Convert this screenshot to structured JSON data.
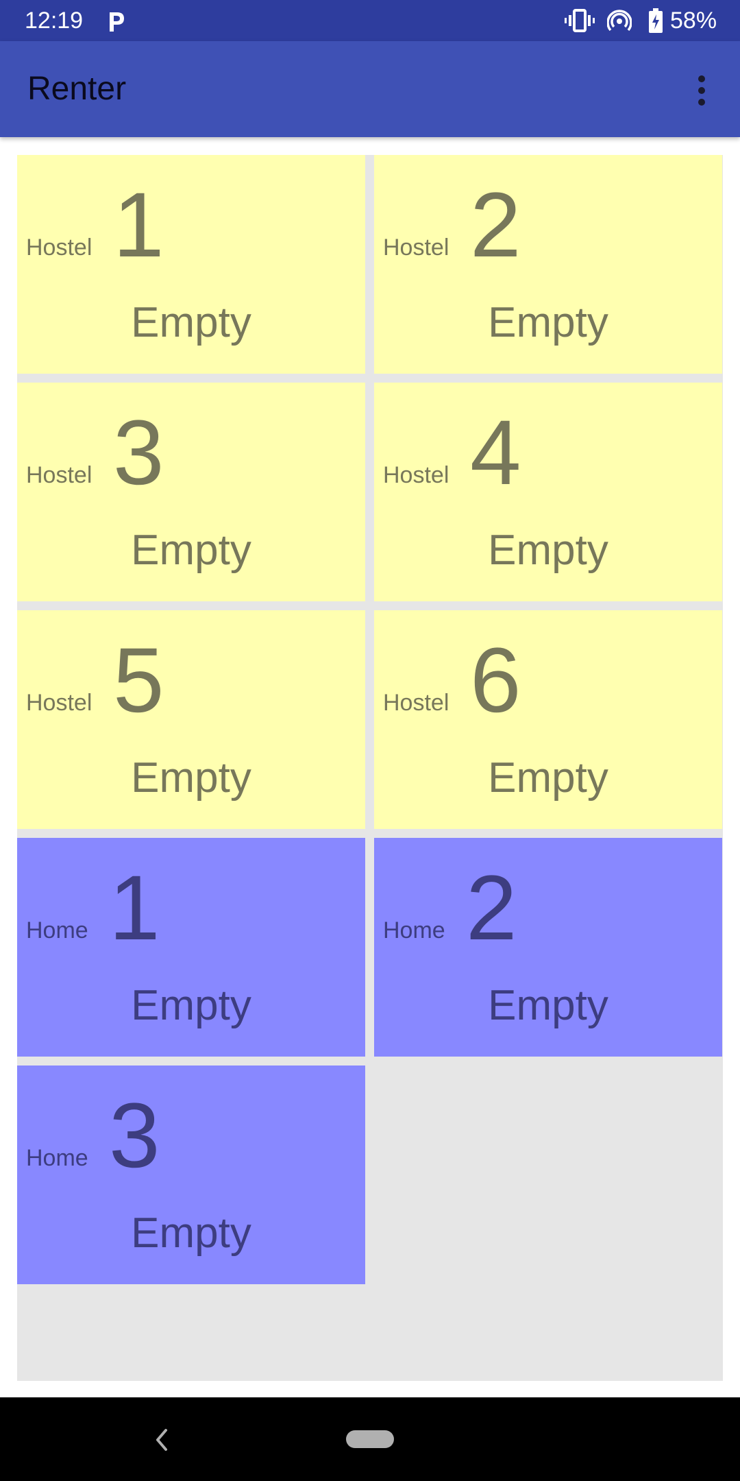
{
  "status_bar": {
    "time": "12:19",
    "battery_percent": "58%",
    "icons": [
      "parking-app-icon",
      "vibrate-icon",
      "hotspot-icon",
      "battery-icon"
    ]
  },
  "app_bar": {
    "title": "Renter",
    "menu_icon": "more-vert-icon"
  },
  "colors": {
    "status_bar": "#2e3d9e",
    "app_bar": "#3f51b5",
    "hostel_tile": "#ffffb0",
    "home_tile": "#8888ff",
    "grid_background": "#e6e6e6"
  },
  "tiles": [
    {
      "kind": "Hostel",
      "number": "1",
      "status": "Empty"
    },
    {
      "kind": "Hostel",
      "number": "2",
      "status": "Empty"
    },
    {
      "kind": "Hostel",
      "number": "3",
      "status": "Empty"
    },
    {
      "kind": "Hostel",
      "number": "4",
      "status": "Empty"
    },
    {
      "kind": "Hostel",
      "number": "5",
      "status": "Empty"
    },
    {
      "kind": "Hostel",
      "number": "6",
      "status": "Empty"
    },
    {
      "kind": "Home",
      "number": "1",
      "status": "Empty"
    },
    {
      "kind": "Home",
      "number": "2",
      "status": "Empty"
    },
    {
      "kind": "Home",
      "number": "3",
      "status": "Empty"
    }
  ],
  "nav_bar": {
    "icons": [
      "back-icon",
      "home-pill-icon"
    ]
  }
}
